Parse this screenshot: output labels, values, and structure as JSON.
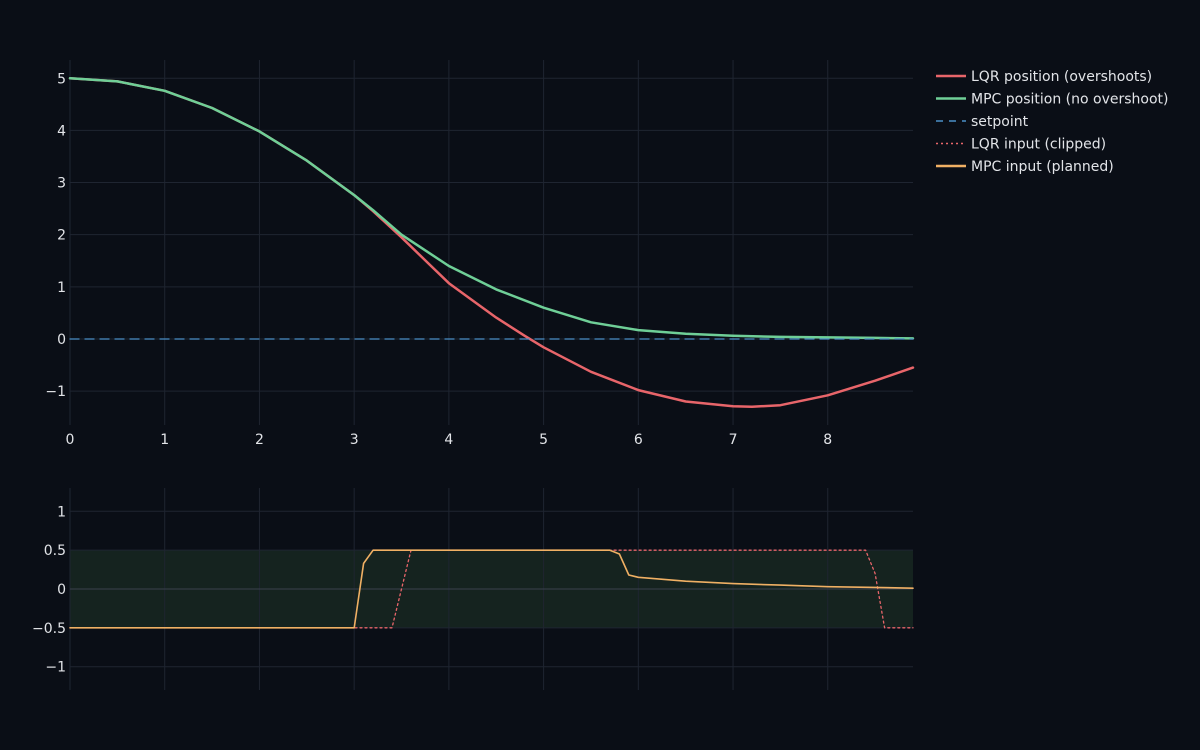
{
  "chart_data": [
    {
      "type": "line",
      "panel": "top",
      "xlim": [
        0,
        8.9
      ],
      "ylim": [
        -1.65,
        5.35
      ],
      "x_ticks": [
        0,
        1,
        2,
        3,
        4,
        5,
        6,
        7,
        8
      ],
      "y_ticks": [
        -1,
        0,
        1,
        2,
        3,
        4,
        5
      ],
      "x_tick_labels": [
        "0",
        "1",
        "2",
        "3",
        "4",
        "5",
        "6",
        "7",
        "8"
      ],
      "y_tick_labels": [
        "−1",
        "0",
        "1",
        "2",
        "3",
        "4",
        "5"
      ],
      "grid": true,
      "series": [
        {
          "name": "LQR position (overshoots)",
          "color": "#e8656a",
          "dash": "solid",
          "x": [
            0,
            0.5,
            1.0,
            1.5,
            2.0,
            2.5,
            3.0,
            3.2,
            3.5,
            3.8,
            4.0,
            4.5,
            4.8,
            5.0,
            5.5,
            6.0,
            6.5,
            7.0,
            7.2,
            7.5,
            8.0,
            8.5,
            8.9
          ],
          "y": [
            5.0,
            4.94,
            4.76,
            4.43,
            3.98,
            3.42,
            2.76,
            2.45,
            1.95,
            1.42,
            1.07,
            0.41,
            0.06,
            -0.16,
            -0.63,
            -0.98,
            -1.2,
            -1.29,
            -1.3,
            -1.27,
            -1.08,
            -0.8,
            -0.55
          ]
        },
        {
          "name": "MPC position (no overshoot)",
          "color": "#6fcf97",
          "dash": "solid",
          "x": [
            0,
            0.5,
            1.0,
            1.5,
            2.0,
            2.5,
            3.0,
            3.2,
            3.5,
            4.0,
            4.5,
            5.0,
            5.5,
            6.0,
            6.5,
            7.0,
            7.5,
            8.0,
            8.5,
            8.9
          ],
          "y": [
            5.0,
            4.94,
            4.76,
            4.43,
            3.98,
            3.42,
            2.76,
            2.47,
            2.0,
            1.4,
            0.95,
            0.6,
            0.32,
            0.17,
            0.1,
            0.06,
            0.04,
            0.03,
            0.02,
            0.01
          ]
        },
        {
          "name": "setpoint",
          "color": "#4a8fc7",
          "dash": "dash",
          "x": [
            0,
            8.9
          ],
          "y": [
            0,
            0
          ]
        }
      ]
    },
    {
      "type": "line",
      "panel": "bottom",
      "xlim": [
        0,
        8.9
      ],
      "ylim": [
        -1.3,
        1.3
      ],
      "x_ticks": [
        0,
        1,
        2,
        3,
        4,
        5,
        6,
        7,
        8
      ],
      "y_ticks": [
        -1,
        -0.5,
        0,
        0.5,
        1
      ],
      "y_tick_labels": [
        "−1",
        "−0.5",
        "0",
        "0.5",
        "1"
      ],
      "grid": true,
      "band": {
        "y0": -0.5,
        "y1": 0.5,
        "color": "#15231f"
      },
      "series": [
        {
          "name": "LQR input (clipped)",
          "color": "#e8656a",
          "dash": "dot",
          "x": [
            0,
            3.0,
            3.4,
            3.6,
            4.0,
            5.0,
            6.0,
            7.0,
            8.0,
            8.4,
            8.5,
            8.6,
            8.9
          ],
          "y": [
            -0.5,
            -0.5,
            -0.5,
            0.5,
            0.5,
            0.5,
            0.5,
            0.5,
            0.5,
            0.5,
            0.2,
            -0.5,
            -0.5
          ]
        },
        {
          "name": "MPC input (planned)",
          "color": "#f0b064",
          "dash": "solid",
          "x": [
            0,
            2.0,
            3.0,
            3.1,
            3.2,
            4.0,
            5.0,
            5.7,
            5.8,
            5.9,
            6.0,
            6.5,
            7.0,
            7.5,
            8.0,
            8.5,
            8.9
          ],
          "y": [
            -0.5,
            -0.5,
            -0.5,
            0.33,
            0.5,
            0.5,
            0.5,
            0.5,
            0.45,
            0.18,
            0.15,
            0.1,
            0.07,
            0.05,
            0.03,
            0.02,
            0.01
          ]
        }
      ]
    }
  ],
  "legend": {
    "placement": "top-right",
    "items": [
      {
        "label": "LQR position (overshoots)",
        "color": "#e8656a",
        "dash": "solid"
      },
      {
        "label": "MPC position (no overshoot)",
        "color": "#6fcf97",
        "dash": "solid"
      },
      {
        "label": "setpoint",
        "color": "#4a8fc7",
        "dash": "dash"
      },
      {
        "label": "LQR input (clipped)",
        "color": "#e8656a",
        "dash": "dot"
      },
      {
        "label": "MPC input (planned)",
        "color": "#f0b064",
        "dash": "solid"
      }
    ]
  },
  "colors": {
    "background": "#0a0e16",
    "grid": "#1f2531",
    "text": "#e2e4e8"
  }
}
